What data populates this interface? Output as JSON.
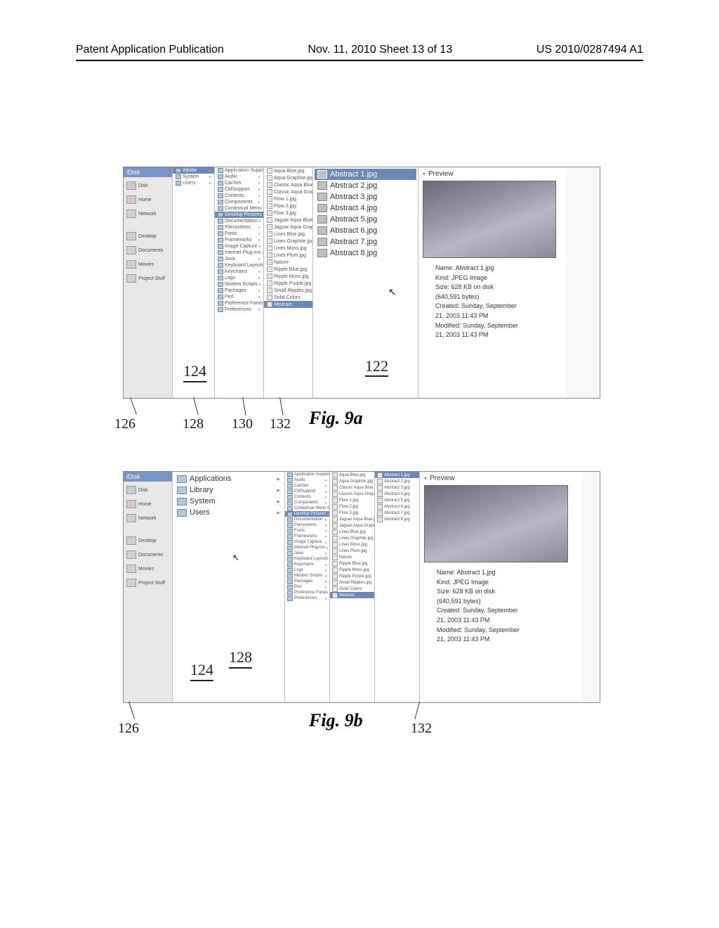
{
  "header": {
    "left": "Patent Application Publication",
    "center": "Nov. 11, 2010  Sheet 13 of 13",
    "right": "US 2010/0287494 A1"
  },
  "sidebar": {
    "header": "iDisk",
    "items": [
      {
        "label": "Disk"
      },
      {
        "label": "Home"
      },
      {
        "label": "Network"
      }
    ],
    "items2": [
      {
        "label": "Desktop"
      },
      {
        "label": "Documents"
      },
      {
        "label": "Movies"
      },
      {
        "label": "Project Stuff"
      }
    ]
  },
  "col1": {
    "items": [
      "Adobe",
      "System",
      "Users"
    ]
  },
  "col2": {
    "items": [
      "Application Support",
      "Audio",
      "Caches",
      "CMSupport",
      "Contexts",
      "Components",
      "Contextual Menu Items",
      "Desktop Pictures",
      "Documentation",
      "Filesystems",
      "Fonts",
      "Frameworks",
      "Image Capture",
      "Internet Plug-Ins",
      "Java",
      "Keyboard Layouts",
      "Keychains",
      "Logs",
      "Modem Scripts",
      "Packages",
      "Perl",
      "Preference Panes",
      "Preferences"
    ],
    "selected": "Desktop Pictures"
  },
  "col3": {
    "items": [
      "Aqua Blue.jpg",
      "Aqua Graphite.jpg",
      "Classic Aqua Blue.jpg",
      "Classic Aqua Graphite.jpg",
      "Flow 1.jpg",
      "Flow 2.jpg",
      "Flow 3.jpg",
      "Jaguar Aqua Blue.jpg",
      "Jaguar Aqua Graphite.jpg",
      "Lines Blue.jpg",
      "Lines Graphite.jpg",
      "Lines Moss.jpg",
      "Lines Plum.jpg",
      "Nature",
      "Ripple Blue.jpg",
      "Ripple Moss.jpg",
      "Ripple Purple.jpg",
      "Small Ripples.jpg",
      "Solid Colors",
      "Abstract"
    ],
    "selected": "Abstract"
  },
  "file_list": {
    "items": [
      "Abstract 1.jpg",
      "Abstract 2.jpg",
      "Abstract 3.jpg",
      "Abstract 4.jpg",
      "Abstract 5.jpg",
      "Abstract 6.jpg",
      "Abstract 7.jpg",
      "Abstract 8.jpg"
    ],
    "selected": "Abstract 1.jpg"
  },
  "preview": {
    "header": "Preview",
    "name": "Name: Abstract 1.jpg",
    "kind": "Kind: JPEG Image",
    "size": "Size: 628 KB on disk",
    "size2": "(640,591 bytes)",
    "created1": "Created: Sunday, September",
    "created2": "21, 2003 11:43 PM",
    "modified1": "Modified: Sunday, September",
    "modified2": "21, 2003 11:43 PM"
  },
  "fig_b": {
    "apps_header": "",
    "sys_rows": [
      "Applications",
      "Library",
      "System",
      "Users"
    ]
  },
  "refs": {
    "r122": "122",
    "r124": "124",
    "r126": "126",
    "r128": "128",
    "r130": "130",
    "r132": "132"
  },
  "labels": {
    "fig_a": "Fig. 9a",
    "fig_b": "Fig. 9b"
  }
}
